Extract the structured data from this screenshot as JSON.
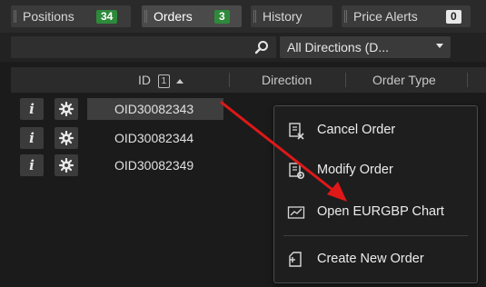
{
  "tabs": [
    {
      "label": "Positions",
      "badge": "34",
      "badge_style": "green"
    },
    {
      "label": "Orders",
      "badge": "3",
      "badge_style": "green"
    },
    {
      "label": "History"
    },
    {
      "label": "Price Alerts",
      "badge": "0",
      "badge_style": "grey"
    }
  ],
  "filter": {
    "search_value": "",
    "direction_selected": "All Directions (D..."
  },
  "columns": {
    "id": "ID",
    "sort_index": "1",
    "direction": "Direction",
    "order_type": "Order Type"
  },
  "rows": [
    {
      "order_id": "OID30082343"
    },
    {
      "order_id": "OID30082344"
    },
    {
      "order_id": "OID30082349"
    }
  ],
  "info_glyph": "i",
  "context_menu": {
    "items": [
      {
        "label": "Cancel Order",
        "icon": "cancel-order-icon"
      },
      {
        "label": "Modify Order",
        "icon": "modify-order-icon"
      },
      {
        "label": "Open EURGBP Chart",
        "icon": "chart-icon"
      },
      {
        "label": "Create New Order",
        "icon": "create-order-icon"
      }
    ]
  },
  "colors": {
    "badge_green": "#2e8a3b",
    "annotation_arrow": "#e01818"
  }
}
